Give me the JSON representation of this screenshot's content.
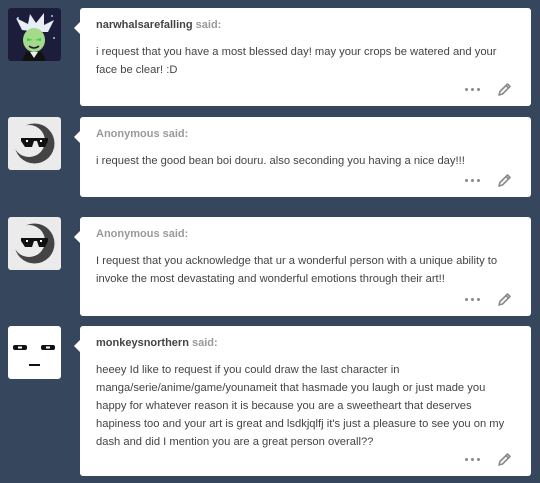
{
  "asks": [
    {
      "asker": "narwhalsarefalling",
      "said": "said:",
      "avatar": "cartoon-character-avatar",
      "text": "i request that you have a most blessed day! may your crops be watered and your face be clear! :D"
    },
    {
      "asker": "Anonymous",
      "said": "said:",
      "avatar": "anonymous-sunglasses-avatar",
      "text": "i request the good bean boi douru. also seconding you having a nice day!!!"
    },
    {
      "asker": "Anonymous",
      "said": "said:",
      "avatar": "anonymous-sunglasses-avatar",
      "text": "I request that you acknowledge that ur a wonderful person with a unique ability to invoke the most devastating and wonderful emotions through their art!!"
    },
    {
      "asker": "monkeysnorthern",
      "said": "said:",
      "avatar": "blank-face-avatar",
      "text": "heeey Id like to request if you could draw the last character in manga/serie/anime/game/younameit that hasmade you laugh or just made you happy for whatever reason it is because you are a sweetheart that deserves hapiness too and your art is great and lsdkjqlfj it's just a pleasure to see you on my dash and did I mention you are a great person overall??"
    }
  ],
  "icons": {
    "more": "more-dots-icon",
    "edit": "pencil-edit-icon"
  },
  "colors": {
    "background": "#36465d",
    "card": "#ffffff",
    "text": "#444444",
    "muted": "#999999"
  }
}
